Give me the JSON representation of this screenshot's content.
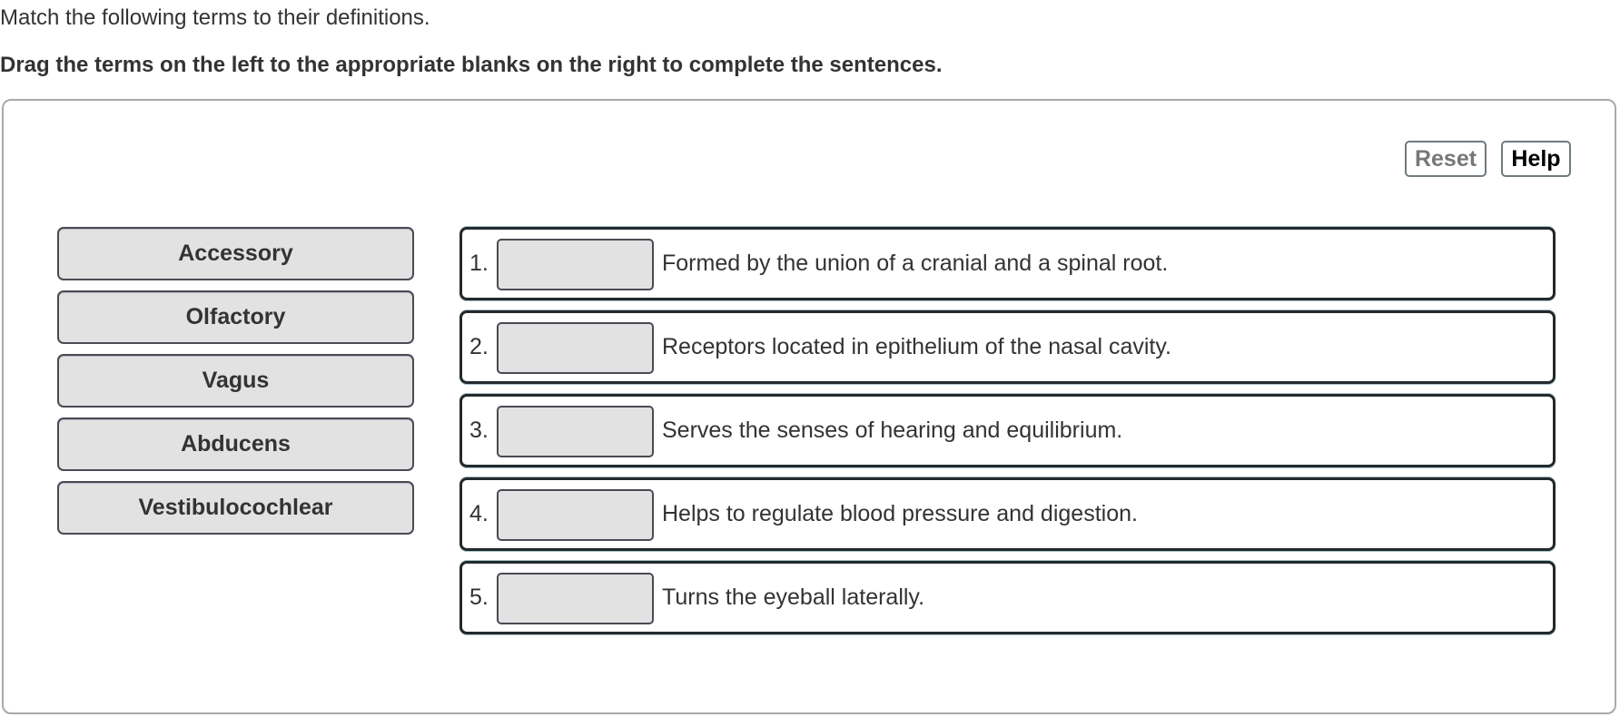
{
  "instructions": {
    "line1": "Match the following terms to their definitions.",
    "line2": "Drag the terms on the left to the appropriate blanks on the right to complete the sentences."
  },
  "toolbar": {
    "reset_label": "Reset",
    "help_label": "Help"
  },
  "terms": [
    {
      "label": "Accessory"
    },
    {
      "label": "Olfactory"
    },
    {
      "label": "Vagus"
    },
    {
      "label": "Abducens"
    },
    {
      "label": "Vestibulocochlear"
    }
  ],
  "items": [
    {
      "number": "1.",
      "blank": "",
      "text": "Formed by the union of a cranial and a spinal root."
    },
    {
      "number": "2.",
      "blank": "",
      "text": "Receptors located in epithelium of the nasal cavity."
    },
    {
      "number": "3.",
      "blank": "",
      "text": "Serves the senses of hearing and equilibrium."
    },
    {
      "number": "4.",
      "blank": "",
      "text": "Helps to regulate blood pressure and digestion."
    },
    {
      "number": "5.",
      "blank": "",
      "text": "Turns the eyeball laterally."
    }
  ],
  "colors": {
    "term_bg": "#e2e2e2",
    "reset_text": "#777777",
    "help_text": "#000000"
  }
}
